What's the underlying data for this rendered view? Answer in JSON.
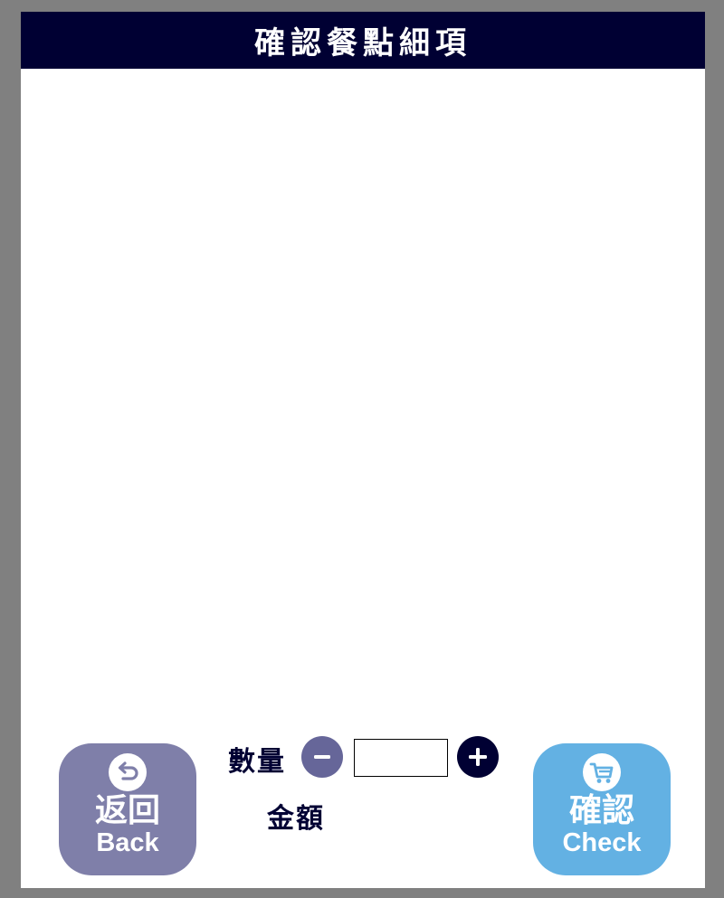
{
  "header": {
    "title": "確認餐點細項"
  },
  "order": {
    "quantity_label": "數量",
    "quantity_value": "",
    "amount_label": "金額",
    "amount_value": ""
  },
  "buttons": {
    "back": {
      "label_zh": "返回",
      "label_en": "Back",
      "icon": "return-arrow-icon",
      "color": "#7f7fa9"
    },
    "check": {
      "label_zh": "確認",
      "label_en": "Check",
      "icon": "shopping-cart-icon",
      "color": "#63b1e3"
    },
    "minus": {
      "icon": "minus-icon",
      "color": "#666699"
    },
    "plus": {
      "icon": "plus-icon",
      "color": "#000033"
    }
  },
  "colors": {
    "header_bg": "#000033",
    "page_bg": "#808080",
    "panel_bg": "#ffffff"
  }
}
